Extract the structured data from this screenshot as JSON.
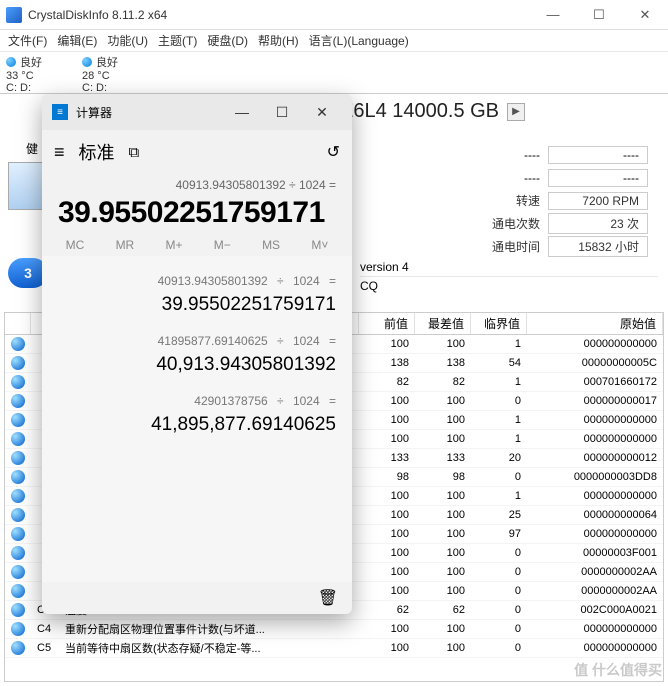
{
  "app": {
    "title": "CrystalDiskInfo 8.11.2 x64"
  },
  "menu": [
    "文件(F)",
    "编辑(E)",
    "功能(U)",
    "主题(T)",
    "硬盘(D)",
    "帮助(H)",
    "语言(L)(Language)"
  ],
  "drives": [
    {
      "status": "良好",
      "temp": "33 °C",
      "letters": "C: D:"
    },
    {
      "status": "良好",
      "temp": "28 °C",
      "letters": "C: D:"
    }
  ],
  "model": "E6L4 14000.5 GB",
  "side_label": "健",
  "dash_rows": [
    {
      "label": "----",
      "val": "----"
    },
    {
      "label": "----",
      "val": "----"
    }
  ],
  "stats": [
    {
      "label": "转速",
      "val": "7200 RPM"
    },
    {
      "label": "通电次数",
      "val": "23 次"
    },
    {
      "label": "通电时间",
      "val": "15832 小时"
    }
  ],
  "version_row": "version 4",
  "acq_row": "CQ",
  "calc_trunc": "00",
  "table": {
    "headers": {
      "cur": "前值",
      "wor": "最差值",
      "thr": "临界值",
      "raw": "原始值"
    },
    "rows": [
      {
        "id": "",
        "name": "",
        "cur": "100",
        "wor": "100",
        "thr": "1",
        "raw": "000000000000"
      },
      {
        "id": "",
        "name": "",
        "cur": "138",
        "wor": "138",
        "thr": "54",
        "raw": "00000000005C"
      },
      {
        "id": "",
        "name": "",
        "cur": "82",
        "wor": "82",
        "thr": "1",
        "raw": "000701660172"
      },
      {
        "id": "",
        "name": "",
        "cur": "100",
        "wor": "100",
        "thr": "0",
        "raw": "000000000017"
      },
      {
        "id": "",
        "name": "",
        "cur": "100",
        "wor": "100",
        "thr": "1",
        "raw": "000000000000"
      },
      {
        "id": "",
        "name": "",
        "cur": "100",
        "wor": "100",
        "thr": "1",
        "raw": "000000000000"
      },
      {
        "id": "",
        "name": "",
        "cur": "133",
        "wor": "133",
        "thr": "20",
        "raw": "000000000012"
      },
      {
        "id": "",
        "name": "",
        "cur": "98",
        "wor": "98",
        "thr": "0",
        "raw": "0000000003DD8"
      },
      {
        "id": "",
        "name": "",
        "cur": "100",
        "wor": "100",
        "thr": "1",
        "raw": "000000000000"
      },
      {
        "id": "",
        "name": "",
        "cur": "100",
        "wor": "100",
        "thr": "25",
        "raw": "000000000064"
      },
      {
        "id": "",
        "name": "",
        "cur": "100",
        "wor": "100",
        "thr": "97",
        "raw": "000000000000"
      },
      {
        "id": "",
        "name": "",
        "cur": "100",
        "wor": "100",
        "thr": "0",
        "raw": "00000003F001"
      },
      {
        "id": "",
        "name": "",
        "cur": "100",
        "wor": "100",
        "thr": "0",
        "raw": "0000000002AA"
      },
      {
        "id": "",
        "name": "",
        "cur": "100",
        "wor": "100",
        "thr": "0",
        "raw": "0000000002AA"
      },
      {
        "id": "C2",
        "name": "温度",
        "cur": "62",
        "wor": "62",
        "thr": "0",
        "raw": "002C000A0021"
      },
      {
        "id": "C4",
        "name": "重新分配扇区物理位置事件计数(与坏道...",
        "cur": "100",
        "wor": "100",
        "thr": "0",
        "raw": "000000000000"
      },
      {
        "id": "C5",
        "name": "当前等待中扇区数(状态存疑/不稳定-等...",
        "cur": "100",
        "wor": "100",
        "thr": "0",
        "raw": "000000000000"
      }
    ]
  },
  "calc": {
    "title": "计算器",
    "mode": "标准",
    "expr": "40913.94305801392 ÷ 1024 =",
    "result": "39.95502251759171",
    "mem": [
      "MC",
      "MR",
      "M+",
      "M−",
      "MS",
      "M˅"
    ],
    "history": [
      {
        "expr": "40913.94305801392   ÷   1024  =",
        "res": "39.95502251759171"
      },
      {
        "expr": "41895877.69140625   ÷   1024  =",
        "res": "40,913.94305801392"
      },
      {
        "expr": "42901378756   ÷   1024  =",
        "res": "41,895,877.69140625"
      }
    ]
  },
  "blue_btn": "3",
  "watermark": "值 什么值得买"
}
